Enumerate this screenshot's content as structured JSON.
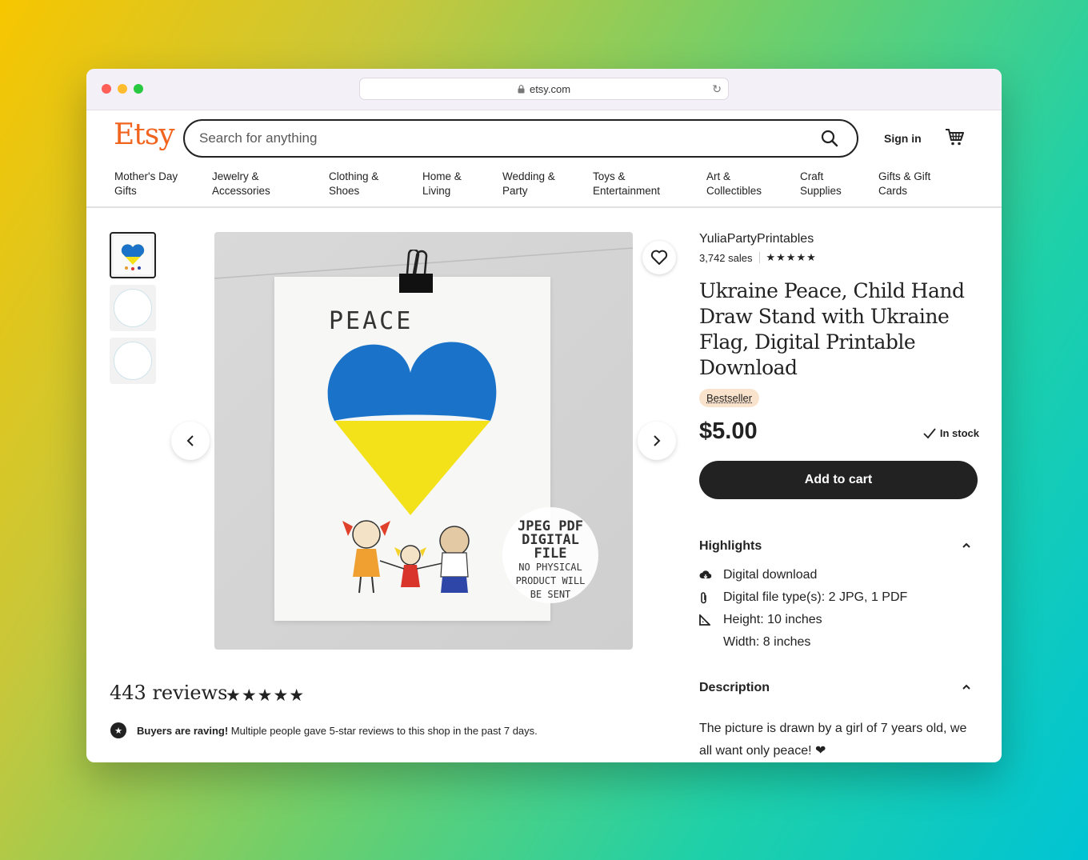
{
  "browser": {
    "url": "etsy.com"
  },
  "header": {
    "logo": "Etsy",
    "search_placeholder": "Search for anything",
    "sign_in": "Sign in"
  },
  "nav": [
    [
      "Mother's Day",
      "Gifts"
    ],
    [
      "Jewelry &",
      "Accessories"
    ],
    [
      "Clothing &",
      "Shoes"
    ],
    [
      "Home &",
      "Living"
    ],
    [
      "Wedding &",
      "Party"
    ],
    [
      "Toys &",
      "Entertainment"
    ],
    [
      "Art &",
      "Collectibles"
    ],
    [
      "Craft",
      "Supplies"
    ],
    [
      "Gifts & Gift",
      "Cards"
    ]
  ],
  "image": {
    "peace_text": "PEACE",
    "badge": {
      "line1": "JPEG PDF",
      "line2": "DIGITAL FILE",
      "line3": "NO PHYSICAL",
      "line4": "PRODUCT WILL",
      "line5": "BE SENT"
    }
  },
  "reviews": {
    "title": "443 reviews",
    "stars": "★★★★★",
    "raving_bold": "Buyers are raving!",
    "raving_text": " Multiple people gave 5-star reviews to this shop in the past 7 days."
  },
  "product": {
    "shop": "YuliaPartyPrintables",
    "sales": "3,742 sales",
    "rating_stars": "★★★★★",
    "title": "Ukraine Peace, Child Hand Draw Stand with Ukraine Flag, Digital Printable Download",
    "badge": "Bestseller",
    "price": "$5.00",
    "stock": "In stock",
    "add_to_cart": "Add to cart",
    "highlights_title": "Highlights",
    "highlights": [
      {
        "icon": "cloud-download-icon",
        "text": "Digital download"
      },
      {
        "icon": "paperclip-icon",
        "text": "Digital file type(s): 2 JPG, 1 PDF"
      },
      {
        "icon": "ruler-icon",
        "text": "Height: 10 inches"
      },
      {
        "icon": "",
        "text": "Width: 8 inches"
      }
    ],
    "description_title": "Description",
    "description": "The picture is drawn by a girl of 7 years old, we all want only peace! ❤"
  },
  "colors": {
    "brand": "#f1641e",
    "ukraine_blue": "#1a73c9",
    "ukraine_yellow": "#f3e21a",
    "bestseller_bg": "#fae3cc"
  }
}
